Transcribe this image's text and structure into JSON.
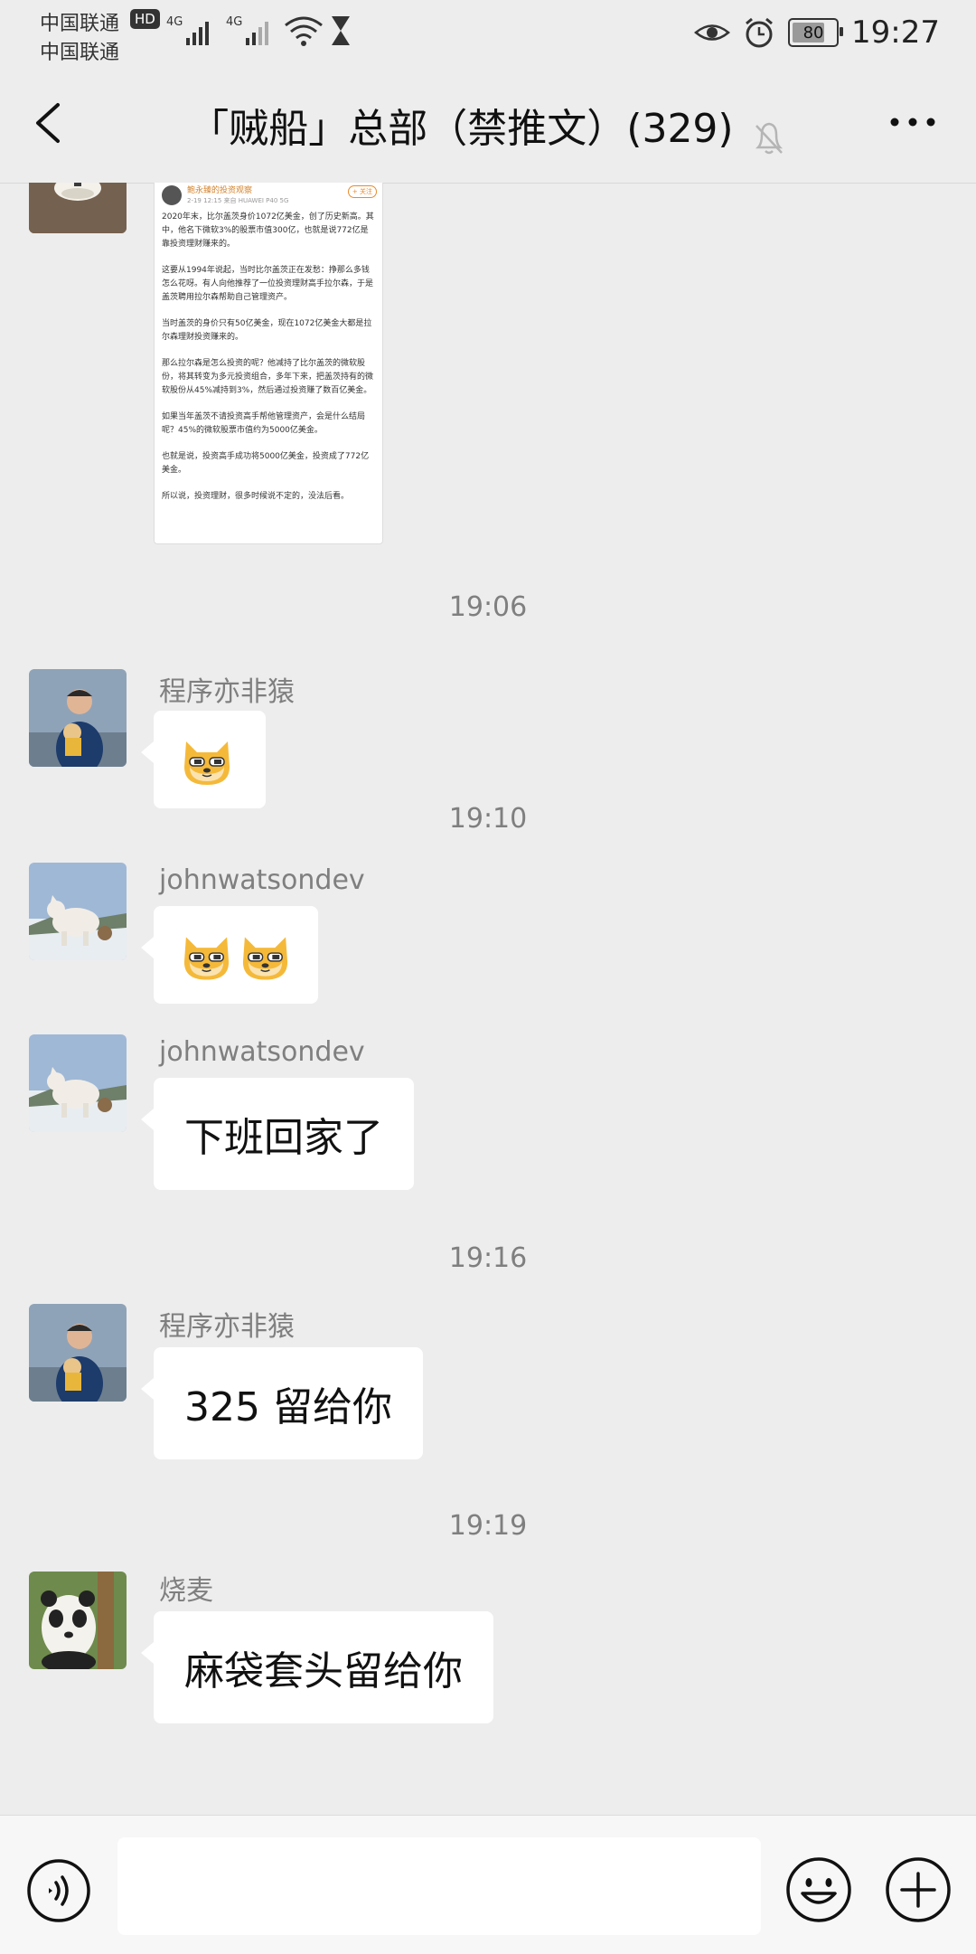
{
  "status_bar": {
    "carrier_1": "中国联通",
    "carrier_2": "中国联通",
    "hd": "HD",
    "network_1": "4G",
    "network_2": "4G",
    "battery": "80",
    "time": "19:27"
  },
  "header": {
    "title": "「贼船」总部（禁推文）(329)"
  },
  "image_message": {
    "author": "鲍永臻的投资观察",
    "meta": "2-19 12:15 来自 HUAWEI P40 5G",
    "follow_label": "+ 关注",
    "paragraphs": [
      "2020年末，比尔盖茨身价1072亿美金，创了历史新高。其中，他名下微软3%的股票市值300亿，也就是说772亿是靠投资理财赚来的。",
      "这要从1994年说起，当时比尔盖茨正在发愁：挣那么多钱怎么花呀。有人向他推荐了一位投资理财高手拉尔森，于是盖茨聘用拉尔森帮助自己管理资产。",
      "当时盖茨的身价只有50亿美金，现在1072亿美金大都是拉尔森理财投资赚来的。",
      "那么拉尔森是怎么投资的呢？他减持了比尔盖茨的微软股份，将其转变为多元投资组合，多年下来，把盖茨持有的微软股份从45%减持到3%，然后通过投资赚了数百亿美金。",
      "如果当年盖茨不请投资高手帮他管理资产，会是什么结局呢？45%的微软股票市值约为5000亿美金。",
      "也就是说，投资高手成功将5000亿美金，投资成了772亿美金。",
      "所以说，投资理财，很多时候说不定的，没法后看。"
    ]
  },
  "messages": [
    {
      "type": "time",
      "text": "19:06"
    },
    {
      "type": "emoji",
      "sender": "程序亦非猿",
      "count": 1
    },
    {
      "type": "time",
      "text": "19:10"
    },
    {
      "type": "emoji",
      "sender": "johnwatsondev",
      "count": 2
    },
    {
      "type": "text",
      "sender": "johnwatsondev",
      "text": "下班回家了"
    },
    {
      "type": "time",
      "text": "19:16"
    },
    {
      "type": "text",
      "sender": "程序亦非猿",
      "text": "325 留给你"
    },
    {
      "type": "time",
      "text": "19:19"
    },
    {
      "type": "text",
      "sender": "烧麦",
      "text": "麻袋套头留给你"
    }
  ],
  "input": {
    "value": "",
    "placeholder": ""
  },
  "icons": {
    "back": "back-arrow-icon",
    "mute": "bell-slash-icon",
    "more": "more-dots-icon",
    "voice": "voice-icon",
    "emoji": "smiley-icon",
    "plus": "plus-circle-icon"
  }
}
